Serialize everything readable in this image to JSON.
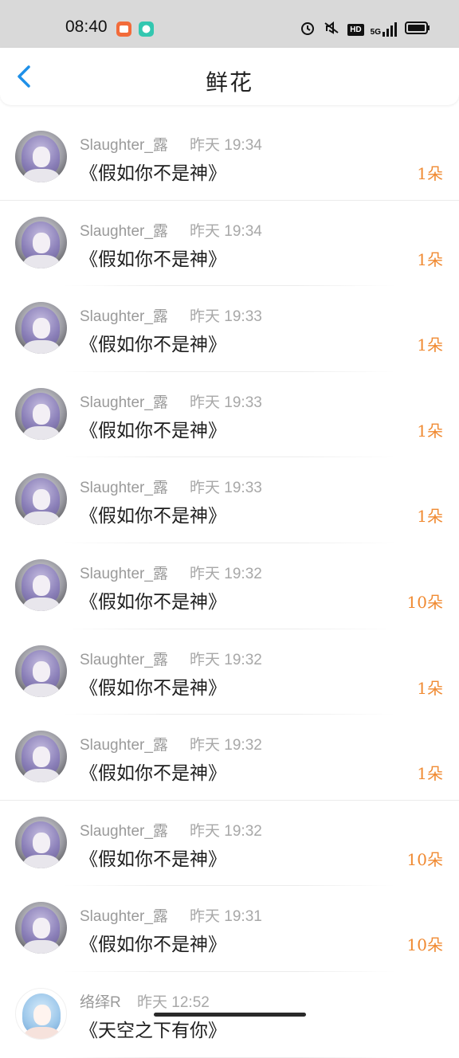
{
  "status_bar": {
    "time": "08:40",
    "icons": [
      "orange-app-icon",
      "green-app-icon",
      "alarm-icon",
      "mute-icon",
      "hd-icon",
      "5g-signal-icon",
      "battery-icon"
    ],
    "hd_label": "HD",
    "network_label": "5G"
  },
  "header": {
    "title": "鲜花",
    "back_icon": "chevron-left-icon",
    "accent": "#1e90e8"
  },
  "colors": {
    "count": "#f08a32",
    "username": "#9a9a9a",
    "title": "#1e1e1e"
  },
  "rows": [
    {
      "user": "Slaughter_露",
      "time": "昨天 19:34",
      "title": "《假如你不是神》",
      "count": "1朵"
    },
    {
      "user": "Slaughter_露",
      "time": "昨天 19:34",
      "title": "《假如你不是神》",
      "count": "1朵"
    },
    {
      "user": "Slaughter_露",
      "time": "昨天 19:33",
      "title": "《假如你不是神》",
      "count": "1朵"
    },
    {
      "user": "Slaughter_露",
      "time": "昨天 19:33",
      "title": "《假如你不是神》",
      "count": "1朵"
    },
    {
      "user": "Slaughter_露",
      "time": "昨天 19:33",
      "title": "《假如你不是神》",
      "count": "1朵"
    },
    {
      "user": "Slaughter_露",
      "time": "昨天 19:32",
      "title": "《假如你不是神》",
      "count": "10朵"
    },
    {
      "user": "Slaughter_露",
      "time": "昨天 19:32",
      "title": "《假如你不是神》",
      "count": "1朵"
    },
    {
      "user": "Slaughter_露",
      "time": "昨天 19:32",
      "title": "《假如你不是神》",
      "count": "1朵"
    },
    {
      "user": "Slaughter_露",
      "time": "昨天 19:32",
      "title": "《假如你不是神》",
      "count": "10朵"
    },
    {
      "user": "Slaughter_露",
      "time": "昨天 19:31",
      "title": "《假如你不是神》",
      "count": "10朵"
    },
    {
      "user": "络绎R",
      "time": "昨天 12:52",
      "title": "《天空之下有你》",
      "count": ""
    }
  ]
}
